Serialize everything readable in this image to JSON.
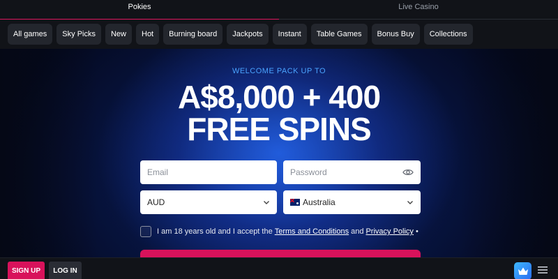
{
  "tabs": [
    {
      "label": "Pokies",
      "active": true
    },
    {
      "label": "Live Casino",
      "active": false
    }
  ],
  "categories": [
    "All games",
    "Sky Picks",
    "New",
    "Hot",
    "Burning board",
    "Jackpots",
    "Instant",
    "Table Games",
    "Bonus Buy",
    "Collections"
  ],
  "hero": {
    "welcome": "WELCOME PACK UP TO",
    "headline_line1": "A$8,000 + 400",
    "headline_line2": "FREE SPINS"
  },
  "form": {
    "email_placeholder": "Email",
    "password_placeholder": "Password",
    "currency_value": "AUD",
    "country_value": "Australia",
    "terms_prefix": "I am 18 years old and I accept the",
    "terms_link": "Terms and Conditions",
    "terms_and": "and",
    "privacy_link": "Privacy Policy",
    "terms_suffix": "•"
  },
  "bottom_bar": {
    "signup_label": "SIGN UP",
    "login_label": "LOG IN"
  },
  "colors": {
    "accent": "#d8125b",
    "welcome_text": "#4aa3ff",
    "crown_icon_bg": "#3db7ff"
  },
  "icons": [
    "eye-icon",
    "chevron-down-icon",
    "australia-flag-icon",
    "crown-icon",
    "hamburger-menu-icon"
  ]
}
